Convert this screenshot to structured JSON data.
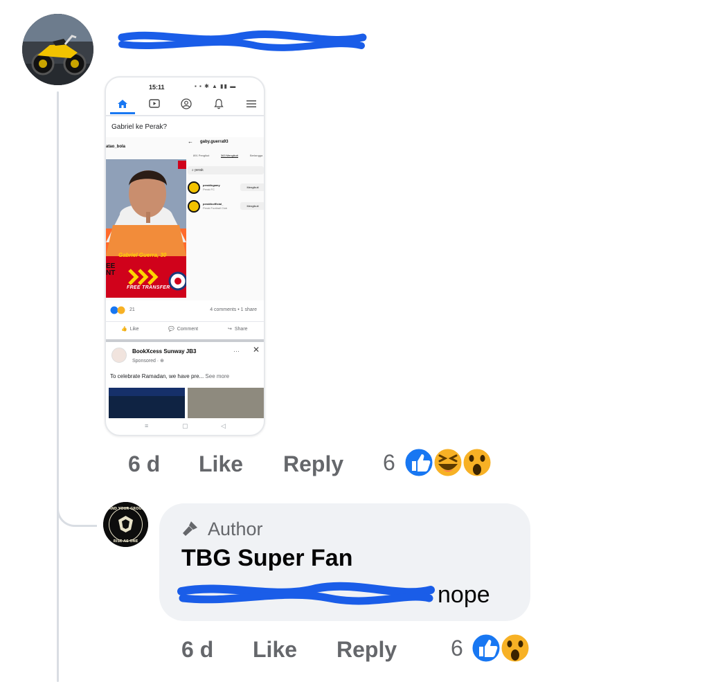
{
  "comment": {
    "avatar_icon": "motorcycle-avatar-icon",
    "time": "6 d",
    "like_label": "Like",
    "reply_label": "Reply",
    "reaction_count": "6",
    "reactions": [
      "like",
      "haha",
      "wow"
    ]
  },
  "embedded_screenshot": {
    "status_time": "15:11",
    "nav_icons": [
      "home-icon",
      "video-icon",
      "profile-icon",
      "bell-icon",
      "menu-icon"
    ],
    "post_text": "Gabriel ke Perak?",
    "ig_account_label": "atao_bola",
    "ig_header_user": "gaby.guerra93",
    "ig_tabs": [
      "891 Pengikut",
      "363 Mengikuti",
      "Berlangga"
    ],
    "ig_search": "perak",
    "ig_rows": [
      {
        "name": "perakfcgamy",
        "sub": "Perak FC",
        "button": "Mengikuti"
      },
      {
        "name": "perakfcofficial_",
        "sub": "Perak Football Club",
        "button": "Mengikuti"
      }
    ],
    "banner_name": "Gabriel Guerra, 30",
    "banner_transfer": "FREE TRANSFER",
    "banner_side_text": "EE\nNT",
    "reactions_count": "21",
    "comments_share": "4 comments • 1 share",
    "actions": [
      "Like",
      "Comment",
      "Share"
    ],
    "ad": {
      "name": "BookXcess Sunway JB3",
      "sponsored": "Sponsored · ",
      "more_icon": "more-dots-icon",
      "close_icon": "close-icon",
      "text": "To celebrate Ramadan, we have pre... ",
      "see_more": "See more"
    }
  },
  "reply": {
    "avatar_text": "STAND YOUR GROUND · RISE AS ONE",
    "author_badge": "Author",
    "author_icon": "microphone-icon",
    "name": "TBG Super Fan",
    "text": "nope",
    "time": "6 d",
    "like_label": "Like",
    "reply_label": "Reply",
    "reaction_count": "6",
    "reactions": [
      "like",
      "wow"
    ]
  },
  "colors": {
    "facebook_blue": "#1877f2",
    "redaction_blue": "#1a5de8",
    "meta_gray": "#65676b",
    "bubble_gray": "#f0f2f5"
  }
}
